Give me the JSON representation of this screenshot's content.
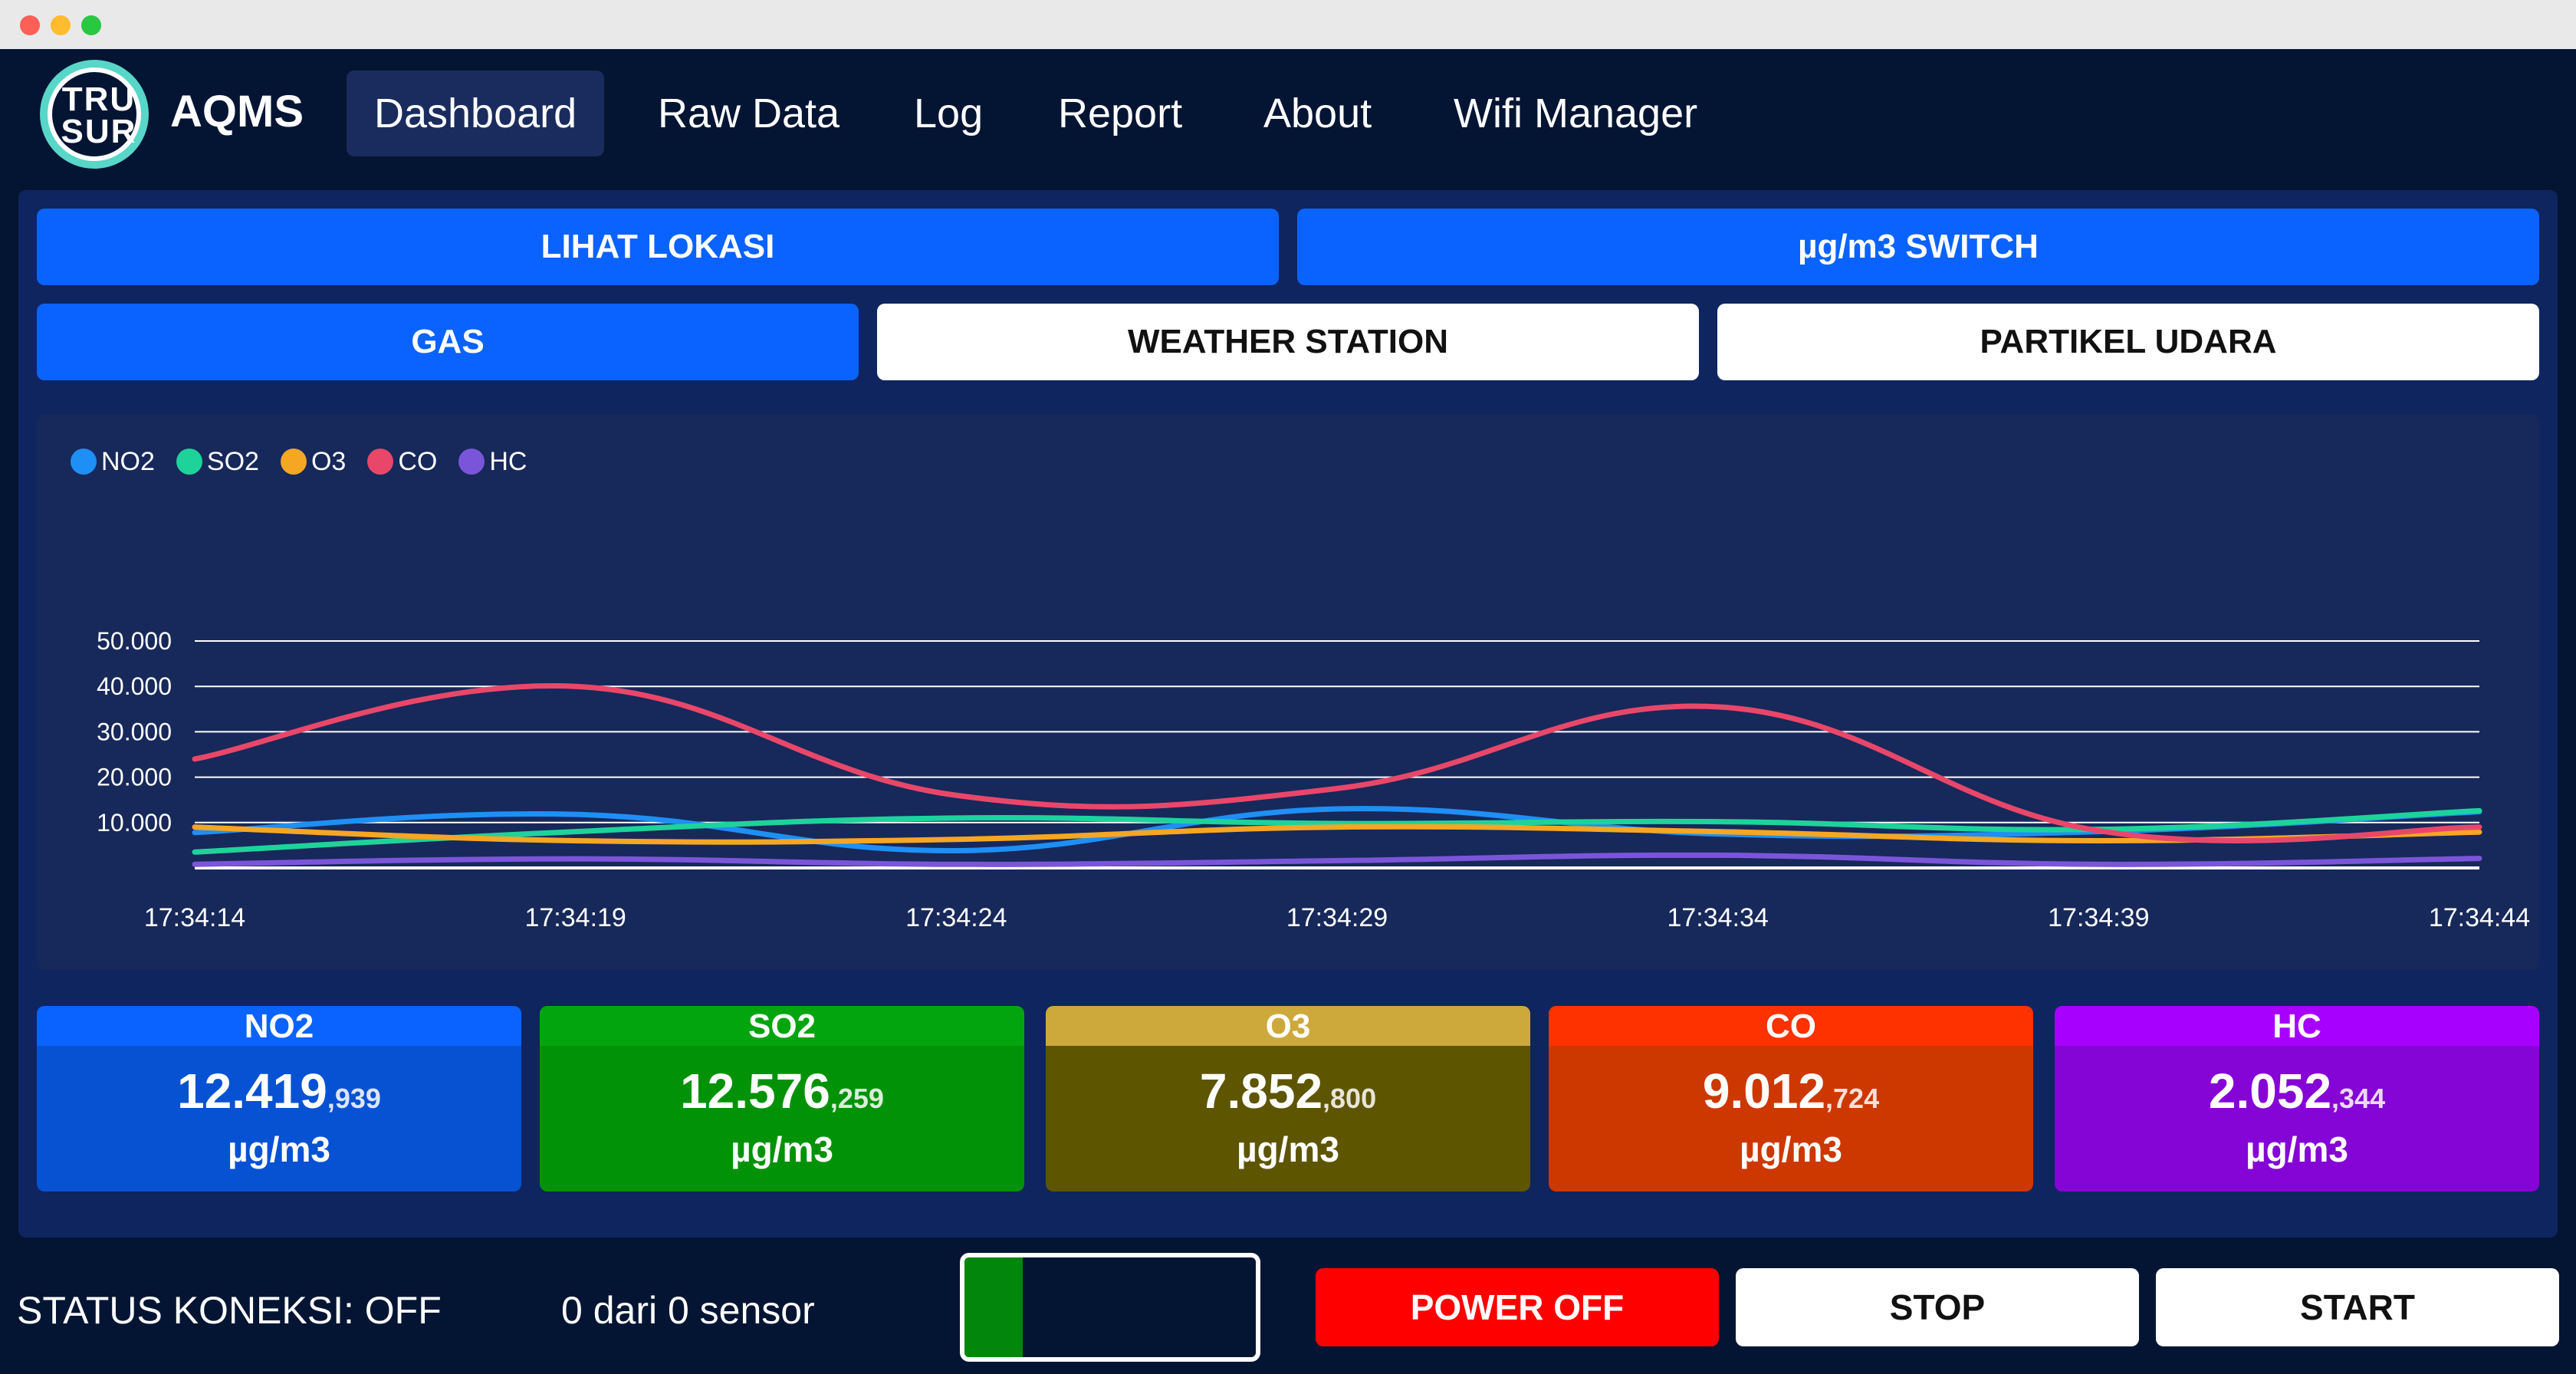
{
  "nav": {
    "logo_text_top": "TRU",
    "logo_text_bottom": "SUR",
    "brand": "AQMS",
    "items": [
      "Dashboard",
      "Raw Data",
      "Log",
      "Report",
      "About",
      "Wifi Manager"
    ],
    "active": "Dashboard"
  },
  "buttons": {
    "lihat_lokasi": "LIHAT LOKASI",
    "unit_switch": "µg/m3 SWITCH",
    "tab_gas": "GAS",
    "tab_weather": "WEATHER STATION",
    "tab_partikel": "PARTIKEL UDARA"
  },
  "chart_data": {
    "type": "line",
    "x": [
      "17:34:14",
      "17:34:19",
      "17:34:24",
      "17:34:29",
      "17:34:34",
      "17:34:39",
      "17:34:44"
    ],
    "y_ticks": [
      "10.000",
      "20.000",
      "30.000",
      "40.000",
      "50.000"
    ],
    "ylim": [
      0,
      50000
    ],
    "grid": true,
    "legend_position": "top-left",
    "series": [
      {
        "name": "NO2",
        "color": "#1e8ff5",
        "values": [
          7800,
          11800,
          3800,
          13000,
          7500,
          8000,
          12400
        ]
      },
      {
        "name": "SO2",
        "color": "#1ed39a",
        "values": [
          3500,
          8000,
          11000,
          9800,
          10200,
          8500,
          12600
        ]
      },
      {
        "name": "O3",
        "color": "#f5a623",
        "values": [
          9000,
          6000,
          6300,
          9000,
          8000,
          6000,
          7900
        ]
      },
      {
        "name": "CO",
        "color": "#e8476a",
        "values": [
          24000,
          40000,
          16000,
          17500,
          35500,
          8200,
          9000
        ]
      },
      {
        "name": "HC",
        "color": "#7b55d9",
        "values": [
          800,
          2000,
          800,
          1600,
          2800,
          800,
          2100
        ]
      }
    ]
  },
  "cards": [
    {
      "name": "NO2",
      "value": "12.419",
      "decimal": ",939",
      "unit": "µg/m3",
      "head_color": "#0a63fe",
      "body_color": "#0752d3"
    },
    {
      "name": "SO2",
      "value": "12.576",
      "decimal": ",259",
      "unit": "µg/m3",
      "head_color": "#03a50e",
      "body_color": "#029208"
    },
    {
      "name": "O3",
      "value": "7.852",
      "decimal": ",800",
      "unit": "µg/m3",
      "head_color": "#cda83b",
      "body_color": "#5e5500"
    },
    {
      "name": "CO",
      "value": "9.012",
      "decimal": ",724",
      "unit": "µg/m3",
      "head_color": "#fe3100",
      "body_color": "#cc3800"
    },
    {
      "name": "HC",
      "value": "2.052",
      "decimal": ",344",
      "unit": "µg/m3",
      "head_color": "#a800ff",
      "body_color": "#8504d6"
    }
  ],
  "footer": {
    "status": "STATUS KONEKSI: OFF",
    "sensor_count": "0 dari 0 sensor",
    "progress_fraction": 0.2,
    "power_off": "POWER OFF",
    "stop": "STOP",
    "start": "START"
  }
}
